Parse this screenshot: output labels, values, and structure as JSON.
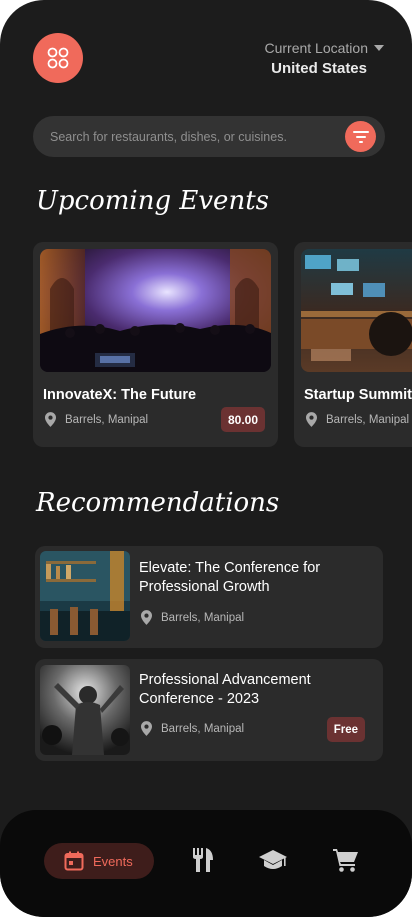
{
  "header": {
    "location_label": "Current Location",
    "location_value": "United States"
  },
  "search": {
    "placeholder": "Search for restaurants, dishes, or cuisines."
  },
  "sections": {
    "upcoming_title": "Upcoming Events",
    "recommendations_title": "Recommendations"
  },
  "upcoming_events": [
    {
      "title": "InnovateX: The Future",
      "location": "Barrels, Manipal",
      "price": "80.00"
    },
    {
      "title": "Startup Summit",
      "location": "Barrels, Manipal"
    }
  ],
  "recommendations": [
    {
      "title": "Elevate: The Conference for Professional Growth",
      "location": "Barrels, Manipal"
    },
    {
      "title": "Professional Advancement Conference - 2023",
      "location": "Barrels, Manipal",
      "price": "Free"
    }
  ],
  "bottom_nav": {
    "active_label": "Events",
    "items": [
      "calendar-icon",
      "utensils-icon",
      "graduation-cap-icon",
      "cart-icon"
    ]
  },
  "colors": {
    "background": "#1c1c1c",
    "accent": "#f06a5b",
    "card": "#2b2b2b",
    "badge": "#6b3232",
    "nav": "#0a0a0a"
  }
}
